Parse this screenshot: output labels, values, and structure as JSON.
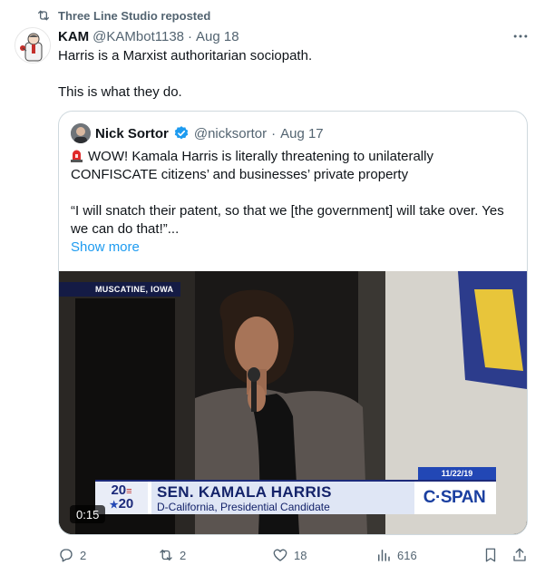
{
  "repost": {
    "label": "Three Line Studio reposted",
    "icon": "repost-icon"
  },
  "tweet": {
    "author_name": "KAM",
    "author_handle": "@KAMbot1138",
    "separator": "·",
    "date": "Aug 18",
    "text_line1": "Harris is a Marxist authoritarian sociopath.",
    "text_line2": "This is what they do."
  },
  "quote": {
    "author_name": "Nick Sortor",
    "author_handle": "@nicksortor",
    "separator": "·",
    "date": "Aug 17",
    "verified": true,
    "text_para1": "WOW! Kamala Harris is literally threatening to unilaterally CONFISCATE citizens’ and businesses’ private property",
    "text_para2": "“I will snatch their patent, so that we [the government] will take over. Yes we can do that!”...",
    "show_more": "Show more",
    "video": {
      "location": "MUSCATINE, IOWA",
      "date_tag": "11/22/19",
      "logo_top": "20",
      "logo_bottom": "20",
      "name": "SEN. KAMALA HARRIS",
      "subtitle": "D-California, Presidential Candidate",
      "network": "C·SPAN",
      "timestamp": "0:15"
    }
  },
  "actions": {
    "replies": "2",
    "reposts": "2",
    "likes": "18",
    "views": "616"
  },
  "colors": {
    "accent": "#1d9bf0",
    "muted": "#536471",
    "border": "#cfd9de",
    "cspan_blue": "#1a3fa0"
  }
}
